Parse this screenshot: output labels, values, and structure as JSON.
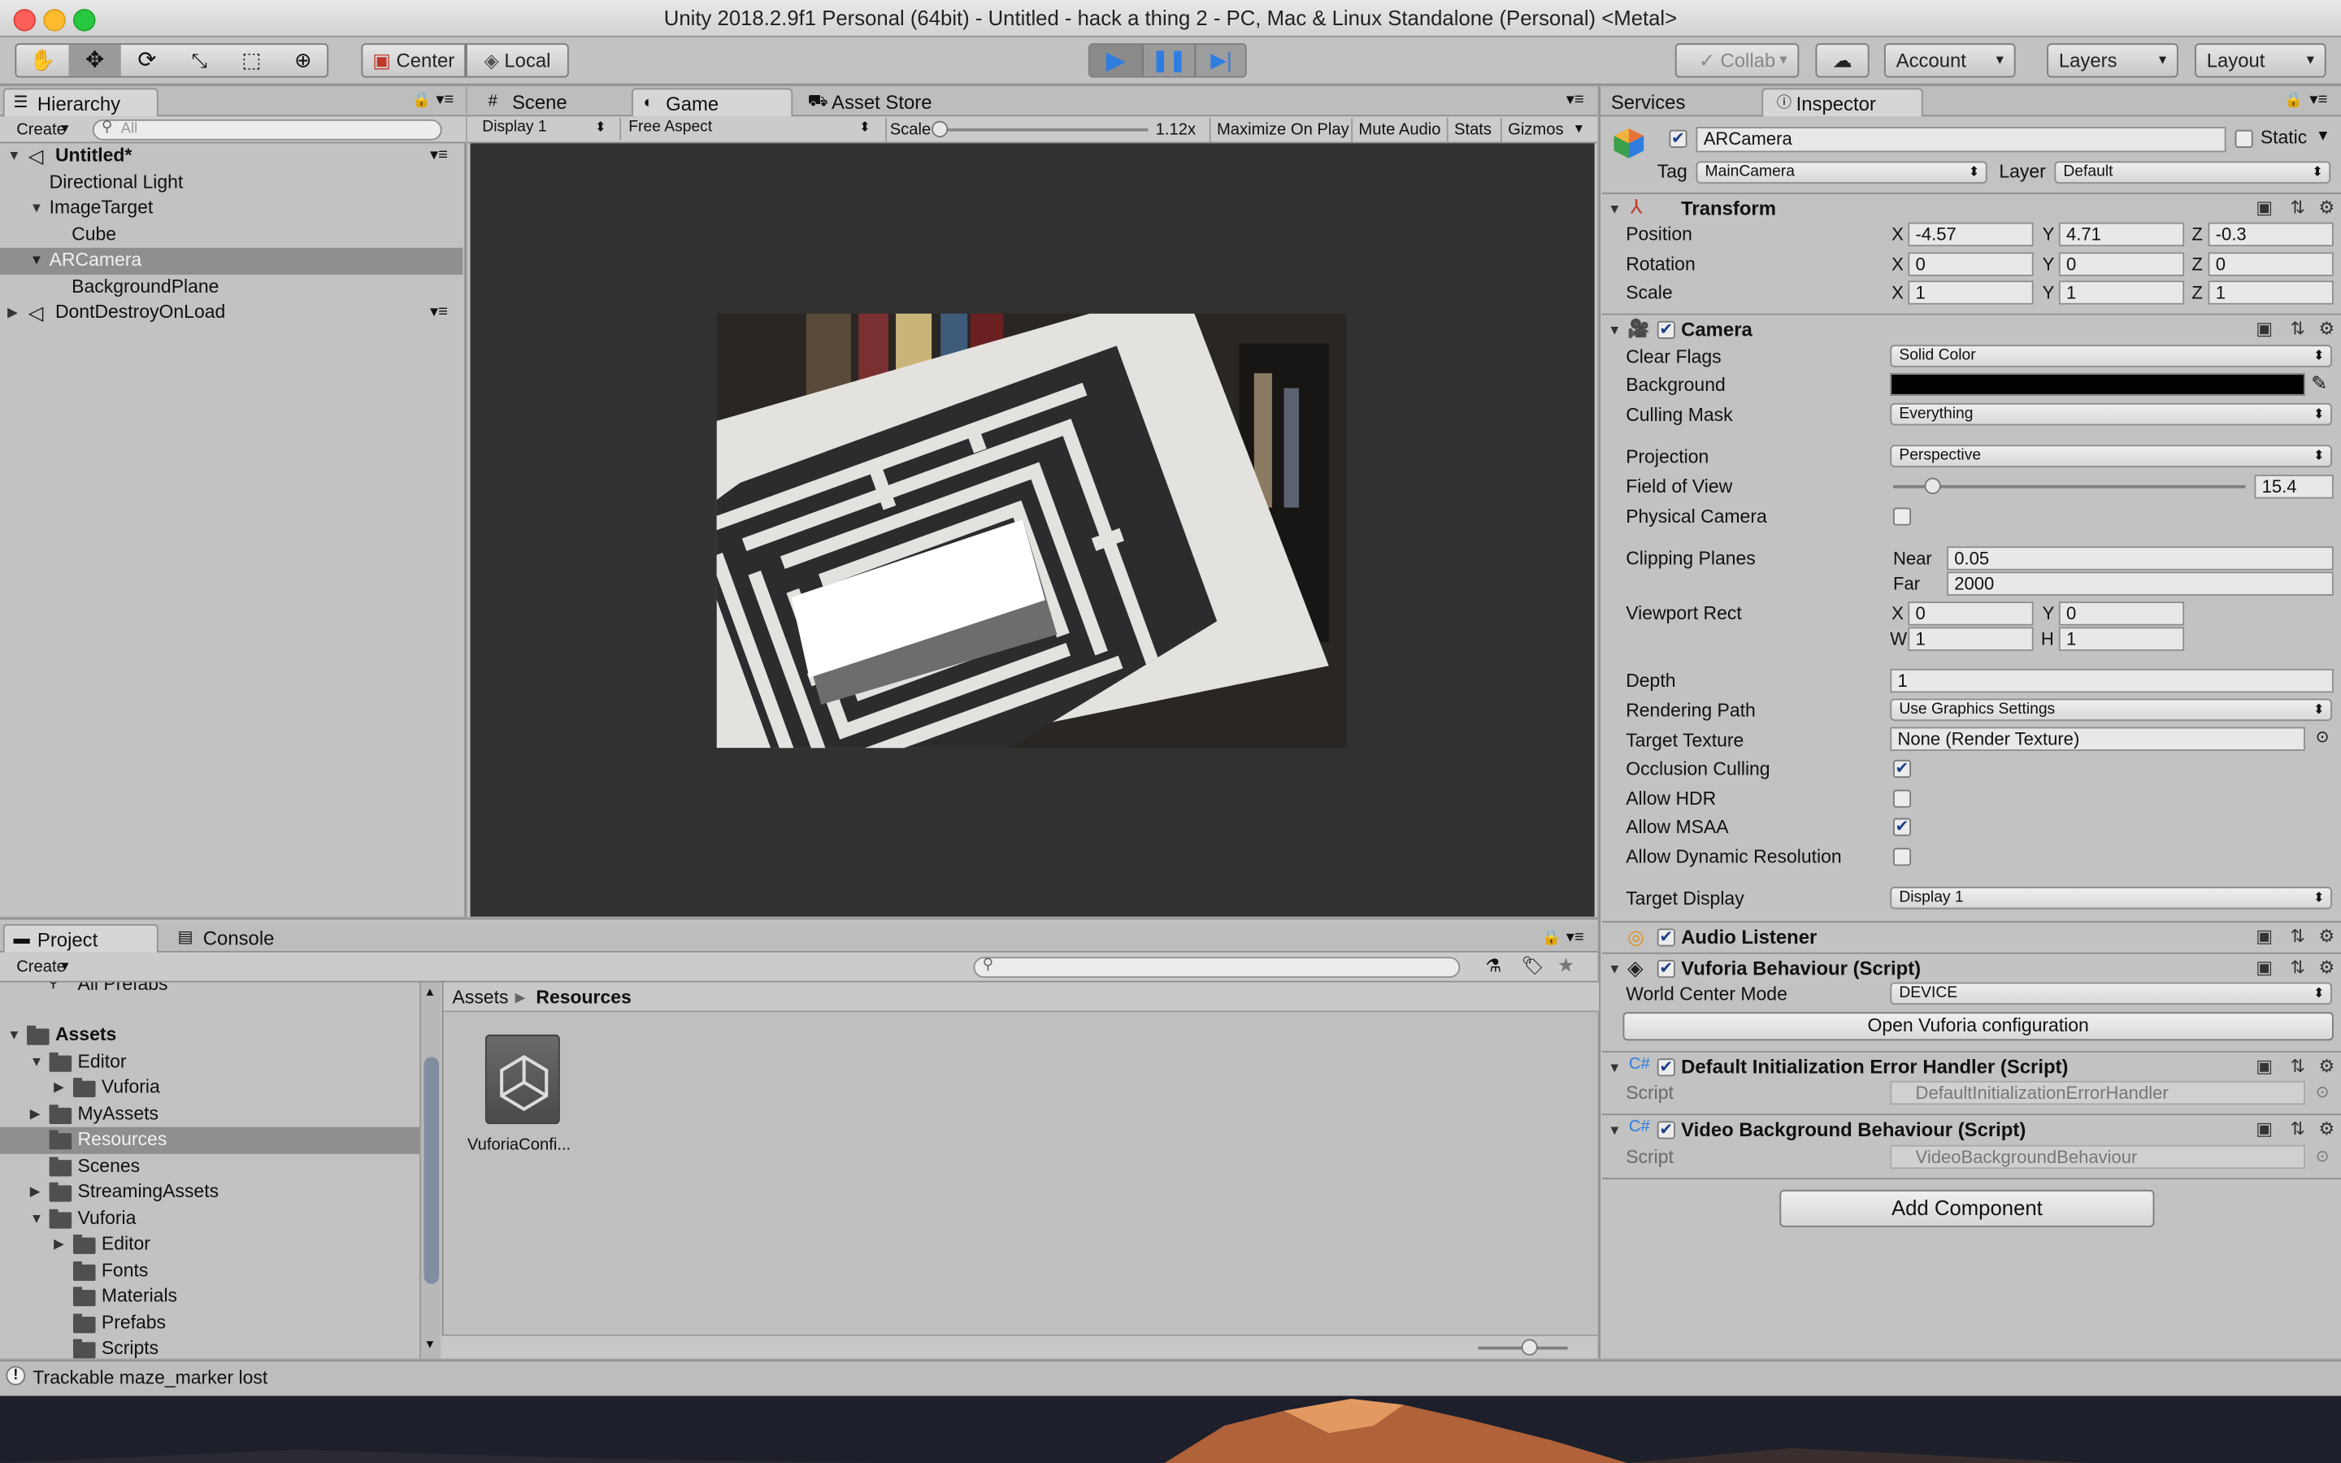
{
  "window": {
    "title": "Unity 2018.2.9f1 Personal (64bit) - Untitled - hack a thing 2 - PC, Mac & Linux Standalone (Personal) <Metal>"
  },
  "toolbar": {
    "pivot": "Center",
    "space": "Local",
    "collab": "Collab",
    "account": "Account",
    "layers": "Layers",
    "layout": "Layout"
  },
  "hierarchy": {
    "tab": "Hierarchy",
    "create": "Create",
    "search_placeholder": "All",
    "items": [
      {
        "label": "Untitled*"
      },
      {
        "label": "Directional Light"
      },
      {
        "label": "ImageTarget"
      },
      {
        "label": "Cube"
      },
      {
        "label": "ARCamera"
      },
      {
        "label": "BackgroundPlane"
      },
      {
        "label": "DontDestroyOnLoad"
      }
    ]
  },
  "game_view": {
    "tabs": [
      {
        "label": "Scene"
      },
      {
        "label": "Game"
      },
      {
        "label": "Asset Store"
      }
    ],
    "display": "Display 1",
    "aspect": "Free Aspect",
    "scale_label": "Scale",
    "scale_value": "1.12x",
    "maximize": "Maximize On Play",
    "mute": "Mute Audio",
    "stats": "Stats",
    "gizmos": "Gizmos"
  },
  "inspector": {
    "tabs": [
      {
        "label": "Services"
      },
      {
        "label": "Inspector"
      }
    ],
    "object_name": "ARCamera",
    "static_label": "Static",
    "tag_label": "Tag",
    "tag_value": "MainCamera",
    "layer_label": "Layer",
    "layer_value": "Default",
    "transform": {
      "title": "Transform",
      "position_label": "Position",
      "position": {
        "x": "-4.57",
        "y": "4.71",
        "z": "-0.3"
      },
      "rotation_label": "Rotation",
      "rotation": {
        "x": "0",
        "y": "0",
        "z": "0"
      },
      "scale_label": "Scale",
      "scale": {
        "x": "1",
        "y": "1",
        "z": "1"
      }
    },
    "camera": {
      "title": "Camera",
      "clear_flags_label": "Clear Flags",
      "clear_flags": "Solid Color",
      "background_label": "Background",
      "background_color": "#000000",
      "culling_mask_label": "Culling Mask",
      "culling_mask": "Everything",
      "projection_label": "Projection",
      "projection": "Perspective",
      "fov_label": "Field of View",
      "fov": "15.4",
      "fov_slider_fraction": 0.11,
      "physical_label": "Physical Camera",
      "physical": false,
      "clipping_label": "Clipping Planes",
      "near_label": "Near",
      "near": "0.05",
      "far_label": "Far",
      "far": "2000",
      "viewport_label": "Viewport Rect",
      "viewport": {
        "x": "0",
        "y": "0",
        "w": "1",
        "h": "1"
      },
      "depth_label": "Depth",
      "depth": "1",
      "rendering_path_label": "Rendering Path",
      "rendering_path": "Use Graphics Settings",
      "target_texture_label": "Target Texture",
      "target_texture": "None (Render Texture)",
      "occlusion_label": "Occlusion Culling",
      "occlusion": true,
      "hdr_label": "Allow HDR",
      "hdr": false,
      "msaa_label": "Allow MSAA",
      "msaa": true,
      "dynres_label": "Allow Dynamic Resolution",
      "dynres": false,
      "target_display_label": "Target Display",
      "target_display": "Display 1"
    },
    "audio_listener": {
      "title": "Audio Listener"
    },
    "vuforia": {
      "title": "Vuforia Behaviour (Script)",
      "world_center_label": "World Center Mode",
      "world_center": "DEVICE",
      "config_button": "Open Vuforia configuration"
    },
    "error_handler": {
      "title": "Default Initialization Error Handler (Script)",
      "script_label": "Script",
      "script": "DefaultInitializationErrorHandler"
    },
    "video_bg": {
      "title": "Video Background Behaviour (Script)",
      "script_label": "Script",
      "script": "VideoBackgroundBehaviour"
    },
    "add_component": "Add Component"
  },
  "project": {
    "tabs": [
      {
        "label": "Project"
      },
      {
        "label": "Console"
      }
    ],
    "create": "Create",
    "tree": [
      {
        "label": "All Prefabs"
      },
      {
        "label": "Assets"
      },
      {
        "label": "Editor"
      },
      {
        "label": "Vuforia"
      },
      {
        "label": "MyAssets"
      },
      {
        "label": "Resources"
      },
      {
        "label": "Scenes"
      },
      {
        "label": "StreamingAssets"
      },
      {
        "label": "Vuforia"
      },
      {
        "label": "Editor"
      },
      {
        "label": "Fonts"
      },
      {
        "label": "Materials"
      },
      {
        "label": "Prefabs"
      },
      {
        "label": "Scripts"
      }
    ],
    "breadcrumb": {
      "root": "Assets",
      "current": "Resources"
    },
    "asset_name": "VuforiaConfi..."
  },
  "status": {
    "message": "Trackable maze_marker lost"
  },
  "colors": {
    "play_blue": "#2f7de1",
    "selection": "#8f8f8f",
    "panel": "#c2c2c2"
  }
}
